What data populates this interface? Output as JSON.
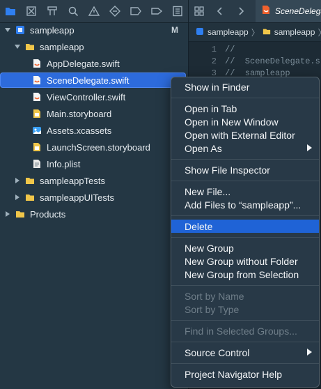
{
  "navigator": {
    "project": "sampleapp",
    "project_badge": "M",
    "items": [
      {
        "label": "sampleapp",
        "kind": "folder"
      },
      {
        "label": "AppDelegate.swift",
        "kind": "swift"
      },
      {
        "label": "SceneDelegate.swift",
        "kind": "swift"
      },
      {
        "label": "ViewController.swift",
        "kind": "swift"
      },
      {
        "label": "Main.storyboard",
        "kind": "storyboard"
      },
      {
        "label": "Assets.xcassets",
        "kind": "assets"
      },
      {
        "label": "LaunchScreen.storyboard",
        "kind": "storyboard"
      },
      {
        "label": "Info.plist",
        "kind": "plist"
      },
      {
        "label": "sampleappTests",
        "kind": "folder"
      },
      {
        "label": "sampleappUITests",
        "kind": "folder"
      },
      {
        "label": "Products",
        "kind": "folder"
      }
    ]
  },
  "editor": {
    "tab_title": "SceneDelega",
    "jump_bar": [
      "sampleapp",
      "sampleapp"
    ],
    "lines": [
      {
        "n": "1",
        "text": "//"
      },
      {
        "n": "2",
        "text": "//  SceneDelegate.s"
      },
      {
        "n": "3",
        "text": "//  sampleapp"
      }
    ]
  },
  "context_menu": {
    "groups": [
      [
        "Show in Finder"
      ],
      [
        "Open in Tab",
        "Open in New Window",
        "Open with External Editor",
        "Open As"
      ],
      [
        "Show File Inspector"
      ],
      [
        "New File...",
        "Add Files to “sampleapp”..."
      ],
      [
        "Delete"
      ],
      [
        "New Group",
        "New Group without Folder",
        "New Group from Selection"
      ],
      [
        "Sort by Name",
        "Sort by Type"
      ],
      [
        "Find in Selected Groups..."
      ],
      [
        "Source Control"
      ],
      [
        "Project Navigator Help"
      ]
    ],
    "highlighted": "Delete",
    "disabled": [
      "Sort by Name",
      "Sort by Type",
      "Find in Selected Groups..."
    ],
    "submenus": [
      "Open As",
      "Source Control"
    ]
  },
  "colors": {
    "selection": "#2d6bdc",
    "menu_highlight": "#1f63d6",
    "accent": "#2f7ff0"
  }
}
